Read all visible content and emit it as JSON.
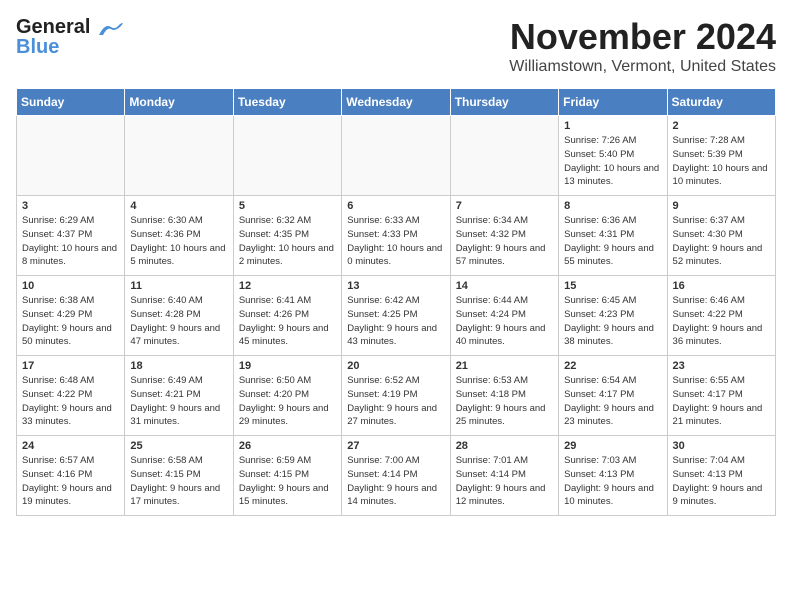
{
  "header": {
    "logo_line1": "General",
    "logo_line2": "Blue",
    "month": "November 2024",
    "location": "Williamstown, Vermont, United States"
  },
  "days_of_week": [
    "Sunday",
    "Monday",
    "Tuesday",
    "Wednesday",
    "Thursday",
    "Friday",
    "Saturday"
  ],
  "weeks": [
    [
      {
        "day": "",
        "info": ""
      },
      {
        "day": "",
        "info": ""
      },
      {
        "day": "",
        "info": ""
      },
      {
        "day": "",
        "info": ""
      },
      {
        "day": "",
        "info": ""
      },
      {
        "day": "1",
        "info": "Sunrise: 7:26 AM\nSunset: 5:40 PM\nDaylight: 10 hours and 13 minutes."
      },
      {
        "day": "2",
        "info": "Sunrise: 7:28 AM\nSunset: 5:39 PM\nDaylight: 10 hours and 10 minutes."
      }
    ],
    [
      {
        "day": "3",
        "info": "Sunrise: 6:29 AM\nSunset: 4:37 PM\nDaylight: 10 hours and 8 minutes."
      },
      {
        "day": "4",
        "info": "Sunrise: 6:30 AM\nSunset: 4:36 PM\nDaylight: 10 hours and 5 minutes."
      },
      {
        "day": "5",
        "info": "Sunrise: 6:32 AM\nSunset: 4:35 PM\nDaylight: 10 hours and 2 minutes."
      },
      {
        "day": "6",
        "info": "Sunrise: 6:33 AM\nSunset: 4:33 PM\nDaylight: 10 hours and 0 minutes."
      },
      {
        "day": "7",
        "info": "Sunrise: 6:34 AM\nSunset: 4:32 PM\nDaylight: 9 hours and 57 minutes."
      },
      {
        "day": "8",
        "info": "Sunrise: 6:36 AM\nSunset: 4:31 PM\nDaylight: 9 hours and 55 minutes."
      },
      {
        "day": "9",
        "info": "Sunrise: 6:37 AM\nSunset: 4:30 PM\nDaylight: 9 hours and 52 minutes."
      }
    ],
    [
      {
        "day": "10",
        "info": "Sunrise: 6:38 AM\nSunset: 4:29 PM\nDaylight: 9 hours and 50 minutes."
      },
      {
        "day": "11",
        "info": "Sunrise: 6:40 AM\nSunset: 4:28 PM\nDaylight: 9 hours and 47 minutes."
      },
      {
        "day": "12",
        "info": "Sunrise: 6:41 AM\nSunset: 4:26 PM\nDaylight: 9 hours and 45 minutes."
      },
      {
        "day": "13",
        "info": "Sunrise: 6:42 AM\nSunset: 4:25 PM\nDaylight: 9 hours and 43 minutes."
      },
      {
        "day": "14",
        "info": "Sunrise: 6:44 AM\nSunset: 4:24 PM\nDaylight: 9 hours and 40 minutes."
      },
      {
        "day": "15",
        "info": "Sunrise: 6:45 AM\nSunset: 4:23 PM\nDaylight: 9 hours and 38 minutes."
      },
      {
        "day": "16",
        "info": "Sunrise: 6:46 AM\nSunset: 4:22 PM\nDaylight: 9 hours and 36 minutes."
      }
    ],
    [
      {
        "day": "17",
        "info": "Sunrise: 6:48 AM\nSunset: 4:22 PM\nDaylight: 9 hours and 33 minutes."
      },
      {
        "day": "18",
        "info": "Sunrise: 6:49 AM\nSunset: 4:21 PM\nDaylight: 9 hours and 31 minutes."
      },
      {
        "day": "19",
        "info": "Sunrise: 6:50 AM\nSunset: 4:20 PM\nDaylight: 9 hours and 29 minutes."
      },
      {
        "day": "20",
        "info": "Sunrise: 6:52 AM\nSunset: 4:19 PM\nDaylight: 9 hours and 27 minutes."
      },
      {
        "day": "21",
        "info": "Sunrise: 6:53 AM\nSunset: 4:18 PM\nDaylight: 9 hours and 25 minutes."
      },
      {
        "day": "22",
        "info": "Sunrise: 6:54 AM\nSunset: 4:17 PM\nDaylight: 9 hours and 23 minutes."
      },
      {
        "day": "23",
        "info": "Sunrise: 6:55 AM\nSunset: 4:17 PM\nDaylight: 9 hours and 21 minutes."
      }
    ],
    [
      {
        "day": "24",
        "info": "Sunrise: 6:57 AM\nSunset: 4:16 PM\nDaylight: 9 hours and 19 minutes."
      },
      {
        "day": "25",
        "info": "Sunrise: 6:58 AM\nSunset: 4:15 PM\nDaylight: 9 hours and 17 minutes."
      },
      {
        "day": "26",
        "info": "Sunrise: 6:59 AM\nSunset: 4:15 PM\nDaylight: 9 hours and 15 minutes."
      },
      {
        "day": "27",
        "info": "Sunrise: 7:00 AM\nSunset: 4:14 PM\nDaylight: 9 hours and 14 minutes."
      },
      {
        "day": "28",
        "info": "Sunrise: 7:01 AM\nSunset: 4:14 PM\nDaylight: 9 hours and 12 minutes."
      },
      {
        "day": "29",
        "info": "Sunrise: 7:03 AM\nSunset: 4:13 PM\nDaylight: 9 hours and 10 minutes."
      },
      {
        "day": "30",
        "info": "Sunrise: 7:04 AM\nSunset: 4:13 PM\nDaylight: 9 hours and 9 minutes."
      }
    ]
  ]
}
